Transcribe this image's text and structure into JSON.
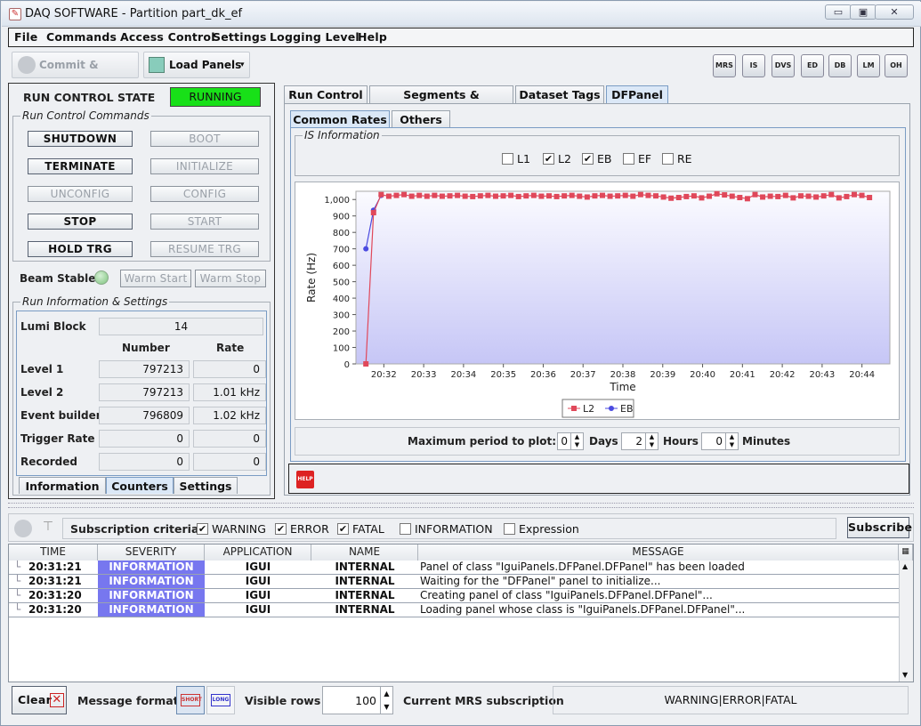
{
  "window": {
    "title": "DAQ SOFTWARE - Partition part_dk_ef",
    "controls": [
      "▭",
      "▣",
      "✕"
    ]
  },
  "menu": [
    "File",
    "Commands",
    "Access Control",
    "Settings",
    "Logging Level",
    "Help"
  ],
  "toolbar": {
    "commit_label": "Commit & Reload",
    "load_label": "Load Panels",
    "icons": [
      "MRS",
      "IS",
      "DVS",
      "ED",
      "DB",
      "LM",
      "OH"
    ]
  },
  "run_control": {
    "state_label": "RUN CONTROL STATE",
    "state_value": "RUNNING",
    "commands_title": "Run Control Commands",
    "commands": [
      {
        "label": "SHUTDOWN",
        "enabled": true
      },
      {
        "label": "BOOT",
        "enabled": false
      },
      {
        "label": "TERMINATE",
        "enabled": true
      },
      {
        "label": "INITIALIZE",
        "enabled": false
      },
      {
        "label": "UNCONFIG",
        "enabled": false
      },
      {
        "label": "CONFIG",
        "enabled": false
      },
      {
        "label": "STOP",
        "enabled": true
      },
      {
        "label": "START",
        "enabled": false
      },
      {
        "label": "HOLD TRG",
        "enabled": true
      },
      {
        "label": "RESUME TRG",
        "enabled": false
      }
    ],
    "beam_label": "Beam Stable",
    "warm_start": "Warm Start",
    "warm_stop": "Warm Stop",
    "info_title": "Run Information & Settings",
    "lumi_label": "Lumi Block",
    "lumi_value": "14",
    "col_number": "Number",
    "col_rate": "Rate",
    "rows": [
      {
        "label": "Level 1",
        "number": "797213",
        "rate": "0"
      },
      {
        "label": "Level 2",
        "number": "797213",
        "rate": "1.01 kHz"
      },
      {
        "label": "Event builder",
        "number": "796809",
        "rate": "1.02 kHz"
      },
      {
        "label": "Trigger Rate",
        "number": "0",
        "rate": "0"
      },
      {
        "label": "Recorded",
        "number": "0",
        "rate": "0"
      }
    ],
    "bottom_tabs": [
      "Information",
      "Counters",
      "Settings"
    ]
  },
  "main_tabs": [
    "Run Control",
    "Segments & Resources",
    "Dataset Tags",
    "DFPanel"
  ],
  "sub_tabs": [
    "Common Rates",
    "Others"
  ],
  "is_info": {
    "title": "IS Information",
    "checks": [
      {
        "label": "L1",
        "checked": false
      },
      {
        "label": "L2",
        "checked": true
      },
      {
        "label": "EB",
        "checked": true
      },
      {
        "label": "EF",
        "checked": false
      },
      {
        "label": "RE",
        "checked": false
      }
    ]
  },
  "chart_data": {
    "type": "line",
    "xlabel": "Time",
    "ylabel": "Rate (Hz)",
    "ylim": [
      0,
      1050
    ],
    "yticks": [
      "0",
      "100",
      "200",
      "300",
      "400",
      "500",
      "600",
      "700",
      "800",
      "900",
      "1,000"
    ],
    "xticks": [
      "20:32",
      "20:33",
      "20:34",
      "20:35",
      "20:36",
      "20:37",
      "20:38",
      "20:39",
      "20:40",
      "20:41",
      "20:42",
      "20:43",
      "20:44"
    ],
    "xlim_minutes": [
      31.3,
      44.7
    ],
    "series": [
      {
        "name": "L2",
        "color": "#e0485a",
        "x_start": 31.55,
        "x_step": 0.1915,
        "values": [
          0,
          920,
          1030,
          1020,
          1025,
          1030,
          1020,
          1025,
          1020,
          1025,
          1020,
          1022,
          1025,
          1020,
          1018,
          1022,
          1025,
          1020,
          1022,
          1025,
          1018,
          1022,
          1025,
          1020,
          1022,
          1018,
          1022,
          1025,
          1020,
          1015,
          1022,
          1025,
          1020,
          1022,
          1025,
          1020,
          1030,
          1025,
          1022,
          1015,
          1008,
          1012,
          1018,
          1022,
          1010,
          1020,
          1035,
          1028,
          1020,
          1012,
          1005,
          1030,
          1015,
          1020,
          1018,
          1025,
          1010,
          1022,
          1020,
          1015,
          1022,
          1030,
          1010,
          1018,
          1030,
          1025,
          1012
        ]
      },
      {
        "name": "EB",
        "color": "#4a4ae0",
        "x_start": 31.55,
        "x_step": 0.1915,
        "values": [
          700,
          935,
          1025
        ]
      }
    ],
    "legend_position": "bottom",
    "grid": false
  },
  "plot_period": {
    "label": "Maximum period to plot:",
    "days": "0",
    "days_label": "Days",
    "hours": "2",
    "hours_label": "Hours",
    "minutes": "0",
    "minutes_label": "Minutes"
  },
  "help_icon": "HELP",
  "subscription": {
    "label": "Subscription criteria",
    "checks": [
      {
        "label": "WARNING",
        "checked": true
      },
      {
        "label": "ERROR",
        "checked": true
      },
      {
        "label": "FATAL",
        "checked": true
      },
      {
        "label": "INFORMATION",
        "checked": false
      },
      {
        "label": "Expression",
        "checked": false
      }
    ],
    "button": "Subscribe"
  },
  "log_table": {
    "headers": [
      "TIME",
      "SEVERITY",
      "APPLICATION",
      "NAME",
      "MESSAGE"
    ],
    "rows": [
      {
        "time": "20:31:21",
        "severity": "INFORMATION",
        "app": "IGUI",
        "name": "INTERNAL",
        "message": "Panel of class \"IguiPanels.DFPanel.DFPanel\" has been loaded"
      },
      {
        "time": "20:31:21",
        "severity": "INFORMATION",
        "app": "IGUI",
        "name": "INTERNAL",
        "message": "Waiting for the \"DFPanel\" panel to initialize..."
      },
      {
        "time": "20:31:20",
        "severity": "INFORMATION",
        "app": "IGUI",
        "name": "INTERNAL",
        "message": "Creating panel of class \"IguiPanels.DFPanel.DFPanel\"..."
      },
      {
        "time": "20:31:20",
        "severity": "INFORMATION",
        "app": "IGUI",
        "name": "INTERNAL",
        "message": "Loading panel whose class is \"IguiPanels.DFPanel.DFPanel\"..."
      }
    ]
  },
  "footer": {
    "clear": "Clear",
    "format_label": "Message format",
    "short_icon": "SHORT",
    "long_icon": "LONG",
    "visible_rows_label": "Visible rows",
    "visible_rows": "100",
    "mrs_label": "Current MRS subscription",
    "mrs_value": "WARNING|ERROR|FATAL"
  }
}
